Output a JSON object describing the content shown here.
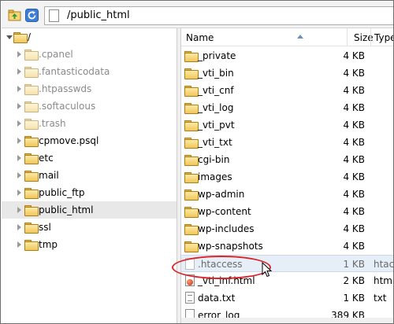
{
  "toolbar": {
    "up_icon": "folder-up-icon",
    "refresh_icon": "refresh-icon",
    "path": "/public_html"
  },
  "tree": {
    "root_label": "/",
    "items": [
      {
        "label": ".cpanel",
        "hidden": true
      },
      {
        "label": ".fantasticodata",
        "hidden": true
      },
      {
        "label": ".htpasswds",
        "hidden": true
      },
      {
        "label": ".softaculous",
        "hidden": true
      },
      {
        "label": ".trash",
        "hidden": true
      },
      {
        "label": "cpmove.psql",
        "hidden": false
      },
      {
        "label": "etc",
        "hidden": false
      },
      {
        "label": "mail",
        "hidden": false
      },
      {
        "label": "public_ftp",
        "hidden": false
      },
      {
        "label": "public_html",
        "hidden": false,
        "selected": true
      },
      {
        "label": "ssl",
        "hidden": false
      },
      {
        "label": "tmp",
        "hidden": false
      }
    ]
  },
  "list": {
    "columns": {
      "name": "Name",
      "size": "Size",
      "type": "Type"
    },
    "rows": [
      {
        "name": "_private",
        "size": "4 KB",
        "type": "",
        "icon": "folder-icon"
      },
      {
        "name": "_vti_bin",
        "size": "4 KB",
        "type": "",
        "icon": "folder-icon"
      },
      {
        "name": "_vti_cnf",
        "size": "4 KB",
        "type": "",
        "icon": "folder-icon"
      },
      {
        "name": "_vti_log",
        "size": "4 KB",
        "type": "",
        "icon": "folder-icon"
      },
      {
        "name": "_vti_pvt",
        "size": "4 KB",
        "type": "",
        "icon": "folder-icon"
      },
      {
        "name": "_vti_txt",
        "size": "4 KB",
        "type": "",
        "icon": "folder-icon"
      },
      {
        "name": "cgi-bin",
        "size": "4 KB",
        "type": "",
        "icon": "folder-icon"
      },
      {
        "name": "images",
        "size": "4 KB",
        "type": "",
        "icon": "folder-icon"
      },
      {
        "name": "wp-admin",
        "size": "4 KB",
        "type": "",
        "icon": "folder-icon"
      },
      {
        "name": "wp-content",
        "size": "4 KB",
        "type": "",
        "icon": "folder-icon"
      },
      {
        "name": "wp-includes",
        "size": "4 KB",
        "type": "",
        "icon": "folder-icon"
      },
      {
        "name": "wp-snapshots",
        "size": "4 KB",
        "type": "",
        "icon": "folder-icon"
      },
      {
        "name": ".htaccess",
        "size": "1 KB",
        "type": "htacc",
        "icon": "file-icon",
        "selected": true
      },
      {
        "name": "_vti_inf.html",
        "size": "2 KB",
        "type": "html",
        "icon": "html-file-icon"
      },
      {
        "name": "data.txt",
        "size": "1 KB",
        "type": "txt",
        "icon": "text-file-icon"
      },
      {
        "name": "error_log",
        "size": "389 KB",
        "type": "",
        "icon": "file-icon"
      }
    ]
  },
  "colors": {
    "highlight_ellipse": "#d8262c",
    "selection": "#e6eef8"
  }
}
